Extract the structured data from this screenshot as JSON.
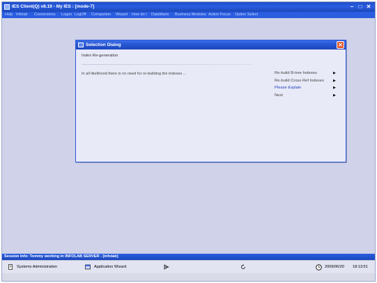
{
  "window": {
    "title": "IES Client(Q) v8.19 - My IES :     [mode-7]",
    "minimize": "–",
    "maximize": "□",
    "close": "✕"
  },
  "menu": [
    "Help",
    "Infolab",
    "Connections",
    "Logon",
    "LogOff",
    "Companion",
    "Wizard",
    "How do I",
    "DataMarts",
    "Business Modules",
    "Action Focus",
    "Option Select"
  ],
  "dialog": {
    "title": "Selection Dialog",
    "close": "✕",
    "subtitle": "Index Re-generation",
    "message": "In all likelihood there is no need for re-building the indexes ...",
    "options": [
      {
        "label": "Re-build B-tree Indexes",
        "arrow": "▶"
      },
      {
        "label": "Re-build Cross Ref Indexes",
        "arrow": "▶"
      },
      {
        "label": "Please Explain",
        "arrow": "▶"
      },
      {
        "label": "Next",
        "arrow": "▶"
      }
    ]
  },
  "session": {
    "info": "Session Info: Tommy working in INFOLAB SERVER - [infolab]"
  },
  "taskbar": {
    "systems_admin": "Systems Administration",
    "app_wizard": "Application Wizard",
    "date": "2009/06/20",
    "time": "18:13:51"
  },
  "colors": {
    "titlebar": "#2a5de0",
    "desktop": "#cfd2e8",
    "dialog_bg": "#e9eaf8",
    "close_button": "#e4572e",
    "highlight_option": "#1f3fb8"
  }
}
